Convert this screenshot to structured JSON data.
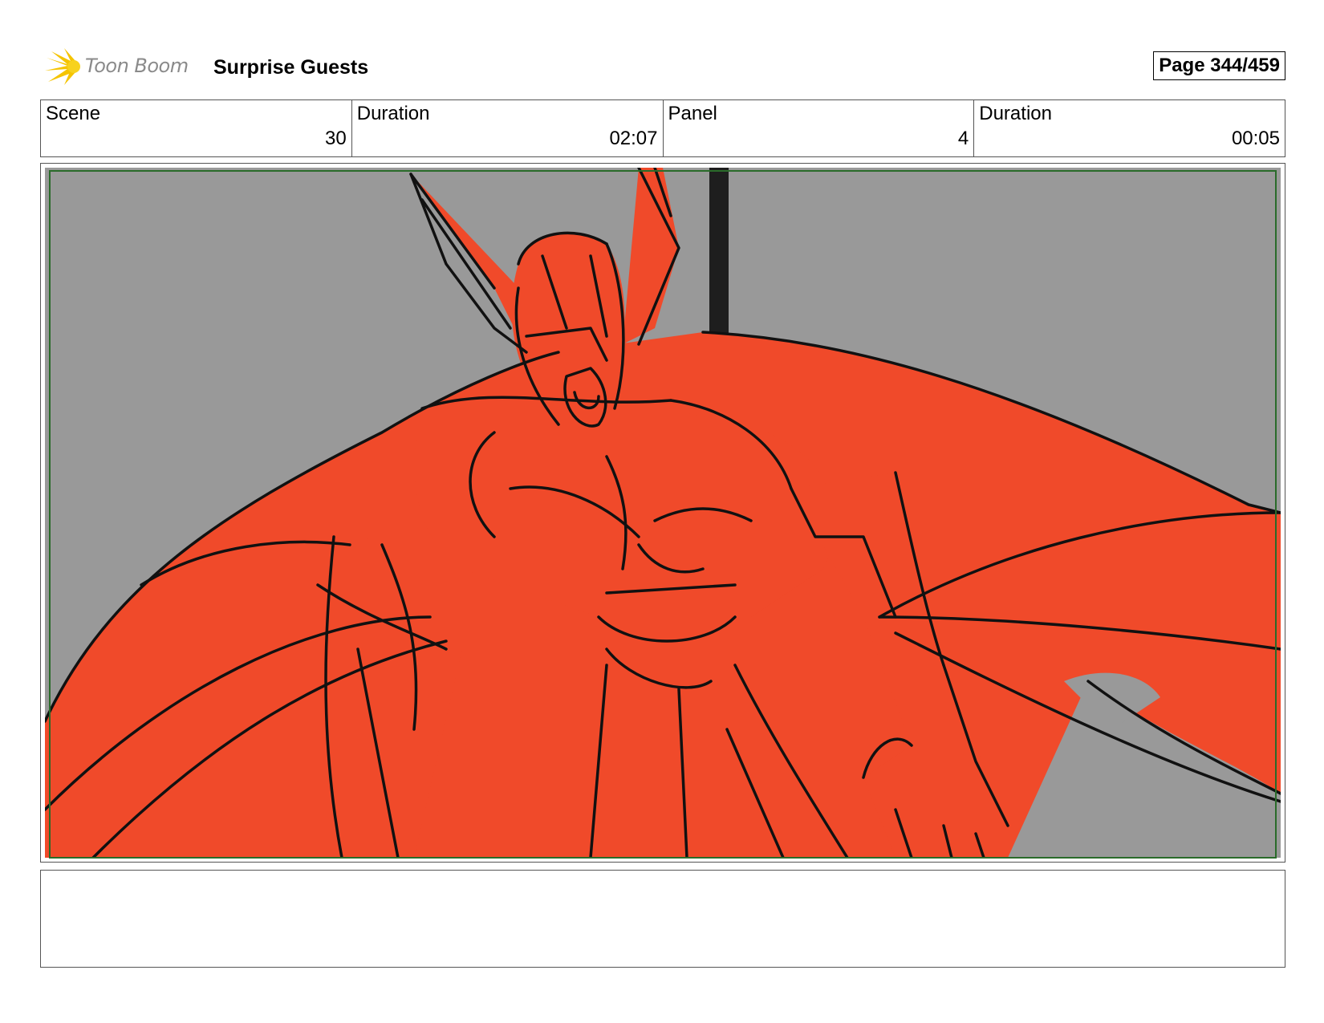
{
  "header": {
    "logo_text": "Toon Boom",
    "project_title": "Surprise Guests",
    "page_counter": "Page 344/459"
  },
  "info": [
    {
      "label": "Scene",
      "value": "30"
    },
    {
      "label": "Duration",
      "value": "02:07"
    },
    {
      "label": "Panel",
      "value": "4"
    },
    {
      "label": "Duration",
      "value": "00:05"
    }
  ],
  "panel": {
    "background_color": "#999999",
    "figure_color": "#f04a2a",
    "line_color": "#111111",
    "safe_frame_color": "#2a6b2a",
    "icon": "storyboard-sketch-bat-demon"
  },
  "notes": {
    "text": ""
  },
  "colors": {
    "logo_flame": "#f5c400",
    "logo_text": "#8a8a8a"
  }
}
